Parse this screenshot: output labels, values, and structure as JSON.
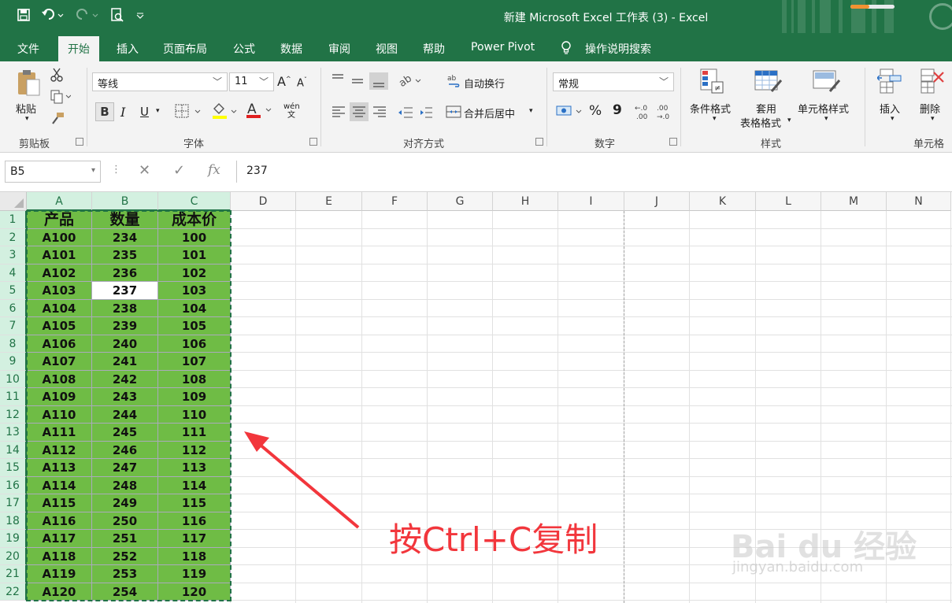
{
  "window": {
    "title": "新建 Microsoft Excel 工作表 (3)  -  Excel",
    "qat": [
      "save-icon",
      "undo-icon",
      "redo-icon",
      "print-preview-icon",
      "customize-icon"
    ]
  },
  "tabs": [
    {
      "label": "文件"
    },
    {
      "label": "开始"
    },
    {
      "label": "插入"
    },
    {
      "label": "页面布局"
    },
    {
      "label": "公式"
    },
    {
      "label": "数据"
    },
    {
      "label": "审阅"
    },
    {
      "label": "视图"
    },
    {
      "label": "帮助"
    },
    {
      "label": "Power Pivot"
    },
    {
      "label": "操作说明搜索"
    }
  ],
  "ribbon": {
    "clipboard": {
      "paste": "粘贴",
      "group": "剪贴板"
    },
    "font": {
      "name": "等线",
      "size": "11",
      "bold": "B",
      "italic": "I",
      "underline": "U",
      "group": "字体",
      "grow": "A",
      "shrink": "A",
      "phonetic": "wén 文"
    },
    "alignment": {
      "wrap": "自动换行",
      "merge": "合并后居中",
      "group": "对齐方式"
    },
    "number": {
      "format": "常规",
      "percent": "%",
      "comma": "9",
      "group": "数字"
    },
    "styles": {
      "conditional": "条件格式",
      "table_1": "套用",
      "table_2": "表格格式",
      "cell_styles": "单元格样式",
      "group": "样式"
    },
    "cells": {
      "insert": "插入",
      "delete": "删除",
      "group": "单元格"
    }
  },
  "formula_bar": {
    "name_box": "B5",
    "value": "237",
    "fx": "fx"
  },
  "columns": [
    "A",
    "B",
    "C",
    "D",
    "E",
    "F",
    "G",
    "H",
    "I",
    "J",
    "K",
    "L",
    "M",
    "N"
  ],
  "rows": [
    "1",
    "2",
    "3",
    "4",
    "5",
    "6",
    "7",
    "8",
    "9",
    "10",
    "11",
    "12",
    "13",
    "14",
    "15",
    "16",
    "17",
    "18",
    "19",
    "20",
    "21",
    "22"
  ],
  "table": {
    "headers": [
      "产品",
      "数量",
      "成本价"
    ],
    "rows": [
      [
        "A100",
        "234",
        "100"
      ],
      [
        "A101",
        "235",
        "101"
      ],
      [
        "A102",
        "236",
        "102"
      ],
      [
        "A103",
        "237",
        "103"
      ],
      [
        "A104",
        "238",
        "104"
      ],
      [
        "A105",
        "239",
        "105"
      ],
      [
        "A106",
        "240",
        "106"
      ],
      [
        "A107",
        "241",
        "107"
      ],
      [
        "A108",
        "242",
        "108"
      ],
      [
        "A109",
        "243",
        "109"
      ],
      [
        "A110",
        "244",
        "110"
      ],
      [
        "A111",
        "245",
        "111"
      ],
      [
        "A112",
        "246",
        "112"
      ],
      [
        "A113",
        "247",
        "113"
      ],
      [
        "A114",
        "248",
        "114"
      ],
      [
        "A115",
        "249",
        "115"
      ],
      [
        "A116",
        "250",
        "116"
      ],
      [
        "A117",
        "251",
        "117"
      ],
      [
        "A118",
        "252",
        "118"
      ],
      [
        "A119",
        "253",
        "119"
      ],
      [
        "A120",
        "254",
        "120"
      ]
    ]
  },
  "annotation": "按Ctrl+C复制",
  "watermark": {
    "logo": "Bai du 经验",
    "url": "jingyan.baidu.com"
  },
  "colors": {
    "excel_green": "#217346",
    "data_fill": "#6fbc45",
    "annotation_red": "#f2363c"
  }
}
